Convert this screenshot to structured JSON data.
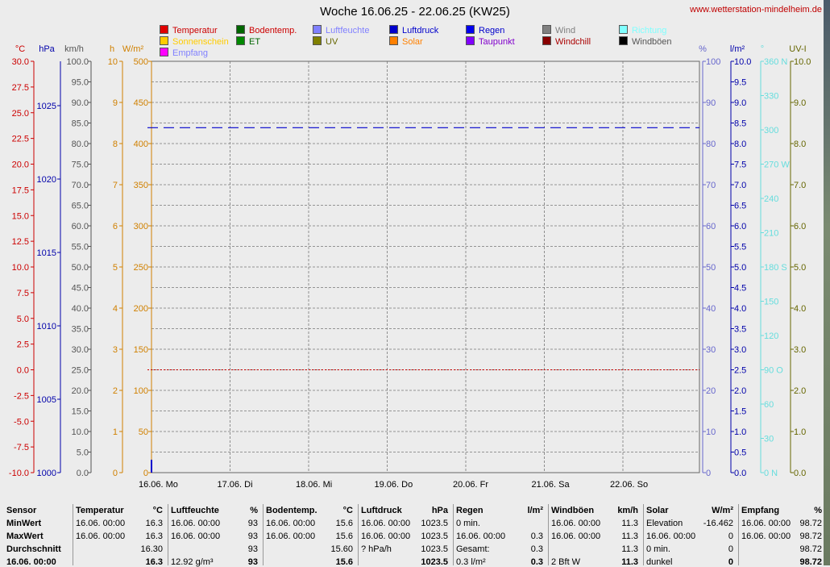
{
  "header": {
    "title": "Woche 16.06.25 - 22.06.25 (KW25)",
    "url": "www.wetterstation-mindelheim.de"
  },
  "colors": {
    "temp": "#cc0000",
    "hpa": "#0000aa",
    "kmh": "#666666",
    "h": "#d08000",
    "wm2": "#d08000",
    "pct": "#6666cc",
    "lm2": "#0000aa",
    "dir": "#66dddd",
    "uvi": "#666600"
  },
  "legend": [
    {
      "label": "Temperatur",
      "swatch": "#e00000",
      "text": "#cc0000"
    },
    {
      "label": "Bodentemp.",
      "swatch": "#006600",
      "text": "#cc0000"
    },
    {
      "label": "Luftfeuchte",
      "swatch": "#8080ff",
      "text": "#8080ff"
    },
    {
      "label": "Luftdruck",
      "swatch": "#0000cc",
      "text": "#0000cc"
    },
    {
      "label": "Regen",
      "swatch": "#0000ee",
      "text": "#0000cc"
    },
    {
      "label": "Wind",
      "swatch": "#808080",
      "text": "#808080"
    },
    {
      "label": "Richtung",
      "swatch": "#80ffff",
      "text": "#80ffff"
    },
    {
      "label": "Sonnenschein",
      "swatch": "#ffcc00",
      "text": "#ffcc00"
    },
    {
      "label": "ET",
      "swatch": "#008800",
      "text": "#006600"
    },
    {
      "label": "UV",
      "swatch": "#808000",
      "text": "#666600"
    },
    {
      "label": "Solar",
      "swatch": "#ff8000",
      "text": "#ff8000"
    },
    {
      "label": "Taupunkt",
      "swatch": "#8000ff",
      "text": "#8000cc"
    },
    {
      "label": "Windchill",
      "swatch": "#880000",
      "text": "#aa0000"
    },
    {
      "label": "Windböen",
      "swatch": "#000000",
      "text": "#555555"
    },
    {
      "label": "Empfang",
      "swatch": "#ff00ff",
      "text": "#8080ff"
    }
  ],
  "axes": {
    "units": [
      {
        "label": "°C",
        "color": "#cc0000"
      },
      {
        "label": "hPa",
        "color": "#0000aa"
      },
      {
        "label": "km/h",
        "color": "#555555"
      },
      {
        "label": "h",
        "color": "#d08000"
      },
      {
        "label": "W/m²",
        "color": "#d08000"
      },
      {
        "label": "%",
        "color": "#6666cc"
      },
      {
        "label": "l/m²",
        "color": "#0000aa"
      },
      {
        "label": "°",
        "color": "#66dddd"
      },
      {
        "label": "UV-I",
        "color": "#666600"
      }
    ],
    "temp_ticks": [
      "30.0",
      "27.5",
      "25.0",
      "22.5",
      "20.0",
      "17.5",
      "15.0",
      "12.5",
      "10.0",
      "7.5",
      "5.0",
      "2.5",
      "0.0",
      "-2.5",
      "-5.0",
      "-7.5",
      "-10.0"
    ],
    "hpa_ticks": [
      "1025",
      "1020",
      "1015",
      "1010",
      "1005",
      "1000"
    ],
    "kmh_ticks": [
      "100.0",
      "95.0",
      "90.0",
      "85.0",
      "80.0",
      "75.0",
      "70.0",
      "65.0",
      "60.0",
      "55.0",
      "50.0",
      "45.0",
      "40.0",
      "35.0",
      "30.0",
      "25.0",
      "20.0",
      "15.0",
      "10.0",
      "5.0",
      "0.0"
    ],
    "h_ticks": [
      "10",
      "9",
      "8",
      "7",
      "6",
      "5",
      "4",
      "3",
      "2",
      "1",
      "0"
    ],
    "wm2_ticks": [
      "500",
      "450",
      "400",
      "350",
      "300",
      "250",
      "200",
      "150",
      "100",
      "50",
      "0"
    ],
    "pct_ticks": [
      "100",
      "90",
      "80",
      "70",
      "60",
      "50",
      "40",
      "30",
      "20",
      "10",
      "0"
    ],
    "lm2_ticks": [
      "10.0",
      "9.5",
      "9.0",
      "8.5",
      "8.0",
      "7.5",
      "7.0",
      "6.5",
      "6.0",
      "5.5",
      "5.0",
      "4.5",
      "4.0",
      "3.5",
      "3.0",
      "2.5",
      "2.0",
      "1.5",
      "1.0",
      "0.5",
      "0.0"
    ],
    "dir_ticks": [
      "360 N",
      "330",
      "300",
      "270 W",
      "240",
      "210",
      "180 S",
      "150",
      "120",
      "90  O",
      "60",
      "30",
      "0    N"
    ],
    "uvi_ticks": [
      "10.0",
      "9.0",
      "8.0",
      "7.0",
      "6.0",
      "5.0",
      "4.0",
      "3.0",
      "2.0",
      "1.0",
      "0.0"
    ],
    "day_labels": [
      "16.06.  Mo",
      "17.06.  Di",
      "18.06.  Mi",
      "19.06.  Do",
      "20.06.  Fr",
      "21.06.  Sa",
      "22.06.  So"
    ]
  },
  "chart_data": {
    "type": "line",
    "title": "Woche 16.06.25 - 22.06.25 (KW25)",
    "x": [
      "16.06.",
      "17.06.",
      "18.06.",
      "19.06.",
      "20.06.",
      "21.06.",
      "22.06."
    ],
    "series": [
      {
        "name": "Luftdruck",
        "unit": "hPa",
        "value": 1023.5,
        "color": "#0000cc",
        "style": "dashed"
      },
      {
        "name": "Temperatur",
        "unit": "°C",
        "value": 0.0,
        "color": "#cc0000",
        "style": "dotted"
      }
    ],
    "ylim_temp": [
      -10,
      30
    ],
    "ylim_hpa": [
      1000,
      1027.5
    ]
  },
  "table": {
    "headers": [
      {
        "label": "Sensor",
        "unit": ""
      },
      {
        "label": "Temperatur",
        "unit": "°C"
      },
      {
        "label": "Luftfeuchte",
        "unit": "%"
      },
      {
        "label": "Bodentemp.",
        "unit": "°C"
      },
      {
        "label": "Luftdruck",
        "unit": "hPa"
      },
      {
        "label": "Regen",
        "unit": "l/m²"
      },
      {
        "label": "Windböen",
        "unit": "km/h"
      },
      {
        "label": "Solar",
        "unit": "W/m²"
      },
      {
        "label": "Empfang",
        "unit": "%"
      }
    ],
    "rows": [
      {
        "label": "MinWert",
        "cells": [
          [
            "16.06.  00:00",
            "16.3"
          ],
          [
            "16.06.  00:00",
            "93"
          ],
          [
            "16.06.  00:00",
            "15.6"
          ],
          [
            "16.06.  00:00",
            "1023.5"
          ],
          [
            "0 min.",
            ""
          ],
          [
            "16.06.  00:00",
            "11.3"
          ],
          [
            "Elevation",
            "-16.462"
          ],
          [
            "16.06.  00:00",
            "98.72"
          ]
        ]
      },
      {
        "label": "MaxWert",
        "cells": [
          [
            "16.06.  00:00",
            "16.3"
          ],
          [
            "16.06.  00:00",
            "93"
          ],
          [
            "16.06.  00:00",
            "15.6"
          ],
          [
            "16.06.  00:00",
            "1023.5"
          ],
          [
            "16.06.  00:00",
            "0.3"
          ],
          [
            "16.06.  00:00",
            "11.3"
          ],
          [
            "16.06.  00:00",
            "0"
          ],
          [
            "16.06.  00:00",
            "98.72"
          ]
        ]
      },
      {
        "label": "Durchschnitt",
        "cells": [
          [
            "",
            "16.30"
          ],
          [
            "",
            "93"
          ],
          [
            "",
            "15.60"
          ],
          [
            "? hPa/h",
            "1023.5"
          ],
          [
            "Gesamt:",
            "0.3"
          ],
          [
            "",
            "11.3"
          ],
          [
            "0 min.",
            "0"
          ],
          [
            "",
            "98.72"
          ]
        ]
      },
      {
        "label": "16.06.  00:00",
        "cells": [
          [
            "",
            "16.3"
          ],
          [
            "12.92 g/m³",
            "93"
          ],
          [
            "",
            "15.6"
          ],
          [
            "",
            "1023.5"
          ],
          [
            "0.3 l/m²",
            "0.3"
          ],
          [
            "2 Bft W",
            "11.3"
          ],
          [
            "dunkel",
            "0"
          ],
          [
            "",
            "98.72"
          ]
        ]
      }
    ]
  }
}
